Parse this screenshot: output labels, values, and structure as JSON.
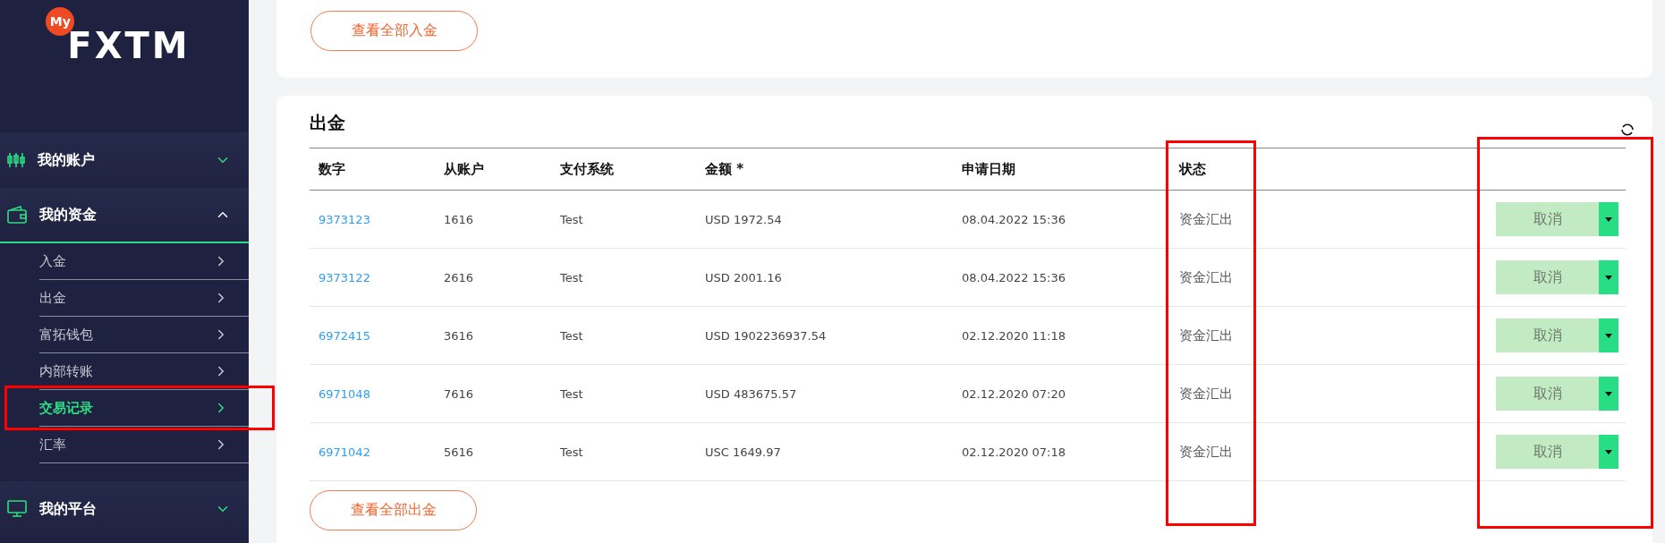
{
  "sidebar": {
    "logo": {
      "badge": "My",
      "text": "FXTM"
    },
    "sections": [
      {
        "kind": "accounts",
        "label": "我的账户",
        "expanded": false
      },
      {
        "kind": "funds",
        "label": "我的资金",
        "expanded": true,
        "children": [
          {
            "label": "入金",
            "selected": false
          },
          {
            "label": "出金",
            "selected": false
          },
          {
            "label": "富拓钱包",
            "selected": false
          },
          {
            "label": "内部转账",
            "selected": false
          },
          {
            "label": "交易记录",
            "selected": true
          },
          {
            "label": "汇率",
            "selected": false
          }
        ]
      },
      {
        "kind": "platforms",
        "label": "我的平台",
        "expanded": false
      }
    ]
  },
  "deposits": {
    "view_all": "查看全部入金"
  },
  "withdrawals": {
    "title": "出金",
    "columns": [
      "数字",
      "从账户",
      "支付系统",
      "金额 *",
      "申请日期",
      "状态"
    ],
    "rows": [
      {
        "id": "9373123",
        "account": "1616",
        "system": "Test",
        "amount": "USD 1972.54",
        "date": "08.04.2022 15:36",
        "status": "资金汇出",
        "action": "取消"
      },
      {
        "id": "9373122",
        "account": "2616",
        "system": "Test",
        "amount": "USD 2001.16",
        "date": "08.04.2022 15:36",
        "status": "资金汇出",
        "action": "取消"
      },
      {
        "id": "6972415",
        "account": "3616",
        "system": "Test",
        "amount": "USD 1902236937.54",
        "date": "02.12.2020 11:18",
        "status": "资金汇出",
        "action": "取消"
      },
      {
        "id": "6971048",
        "account": "7616",
        "system": "Test",
        "amount": "USD 483675.57",
        "date": "02.12.2020 07:20",
        "status": "资金汇出",
        "action": "取消"
      },
      {
        "id": "6971042",
        "account": "5616",
        "system": "Test",
        "amount": "USC 1649.97",
        "date": "02.12.2020 07:18",
        "status": "资金汇出",
        "action": "取消"
      }
    ],
    "view_all": "查看全部出金"
  }
}
